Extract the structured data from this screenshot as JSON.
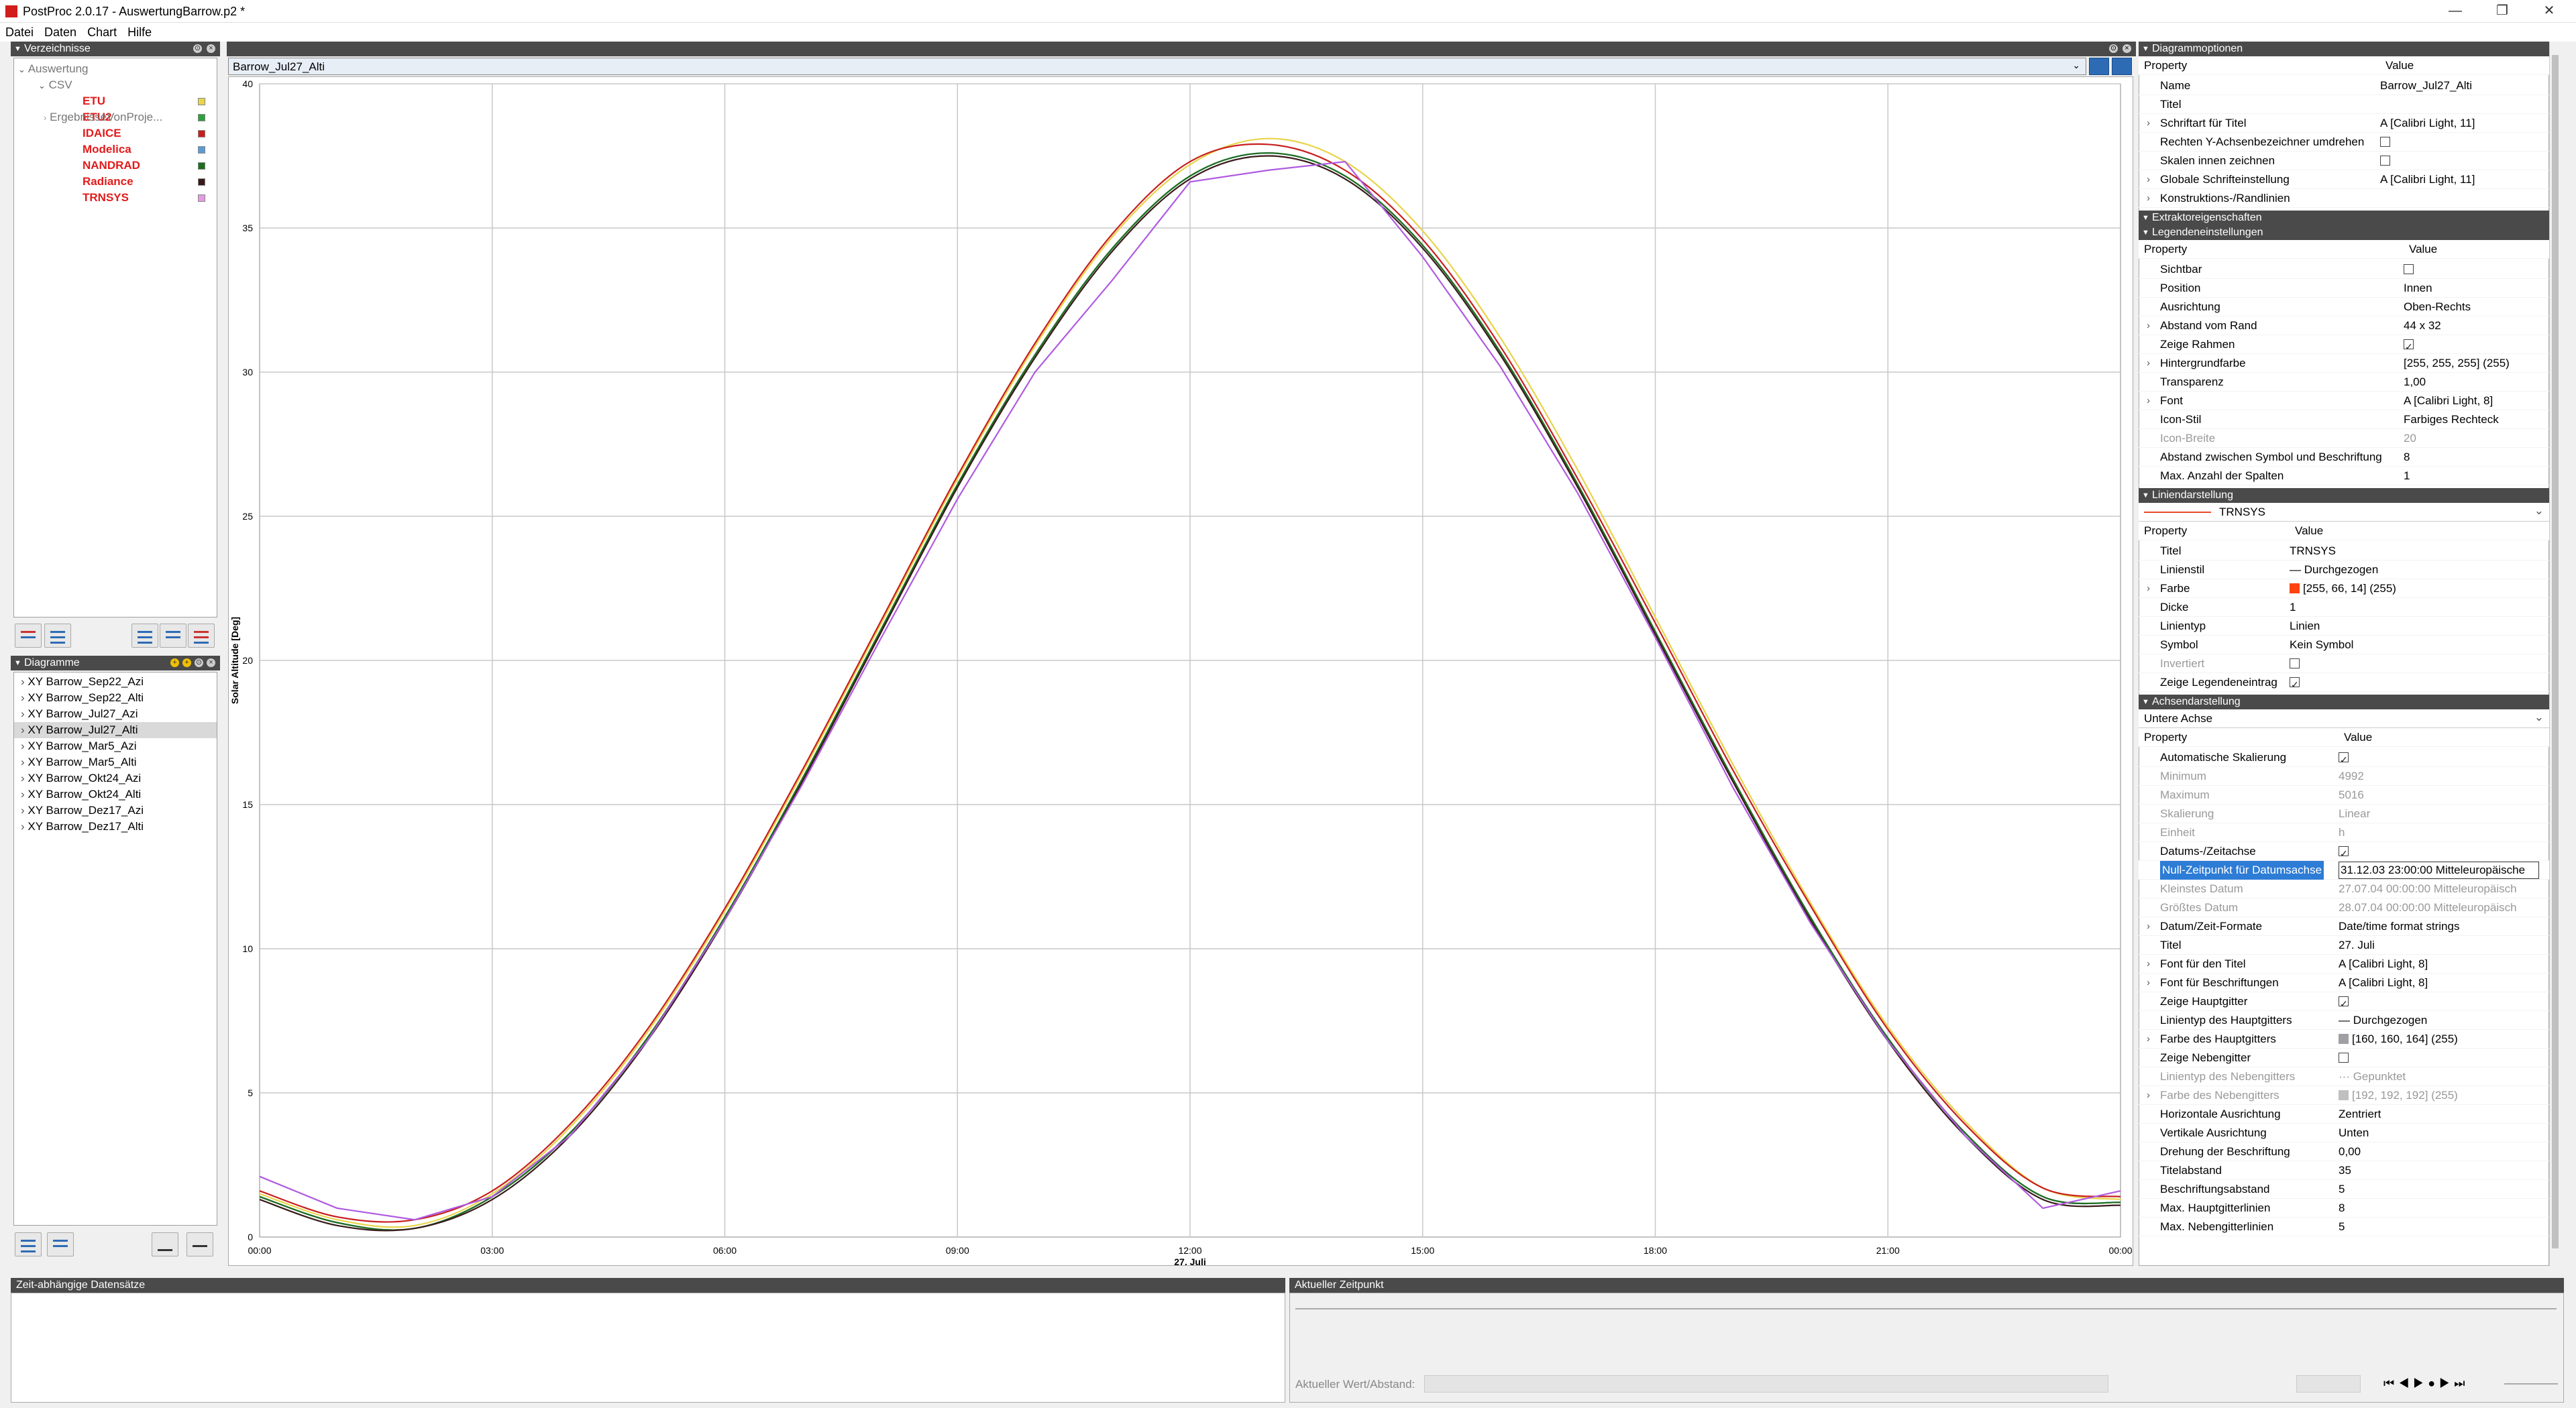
{
  "window": {
    "title": "PostProc 2.0.17 - AuswertungBarrow.p2 *",
    "min": "—",
    "max": "❐",
    "close": "✕"
  },
  "menu": [
    "Datei",
    "Daten",
    "Chart",
    "Hilfe"
  ],
  "verzeichnisse": {
    "title": "Verzeichnisse",
    "root": "Auswertung",
    "csv": "CSV",
    "items": [
      {
        "label": "ETU",
        "color": "#e8d44a"
      },
      {
        "label": "ETU2",
        "color": "#2e9e3e"
      },
      {
        "label": "IDAICE",
        "color": "#c81e1e"
      },
      {
        "label": "Modelica",
        "color": "#5b9bd5"
      },
      {
        "label": "NANDRAD",
        "color": "#1e6e1e"
      },
      {
        "label": "Radiance",
        "color": "#3a1a1a"
      },
      {
        "label": "TRNSYS",
        "color": "#e39be3"
      }
    ],
    "other": "ErgebnisseVonProje..."
  },
  "diagramme": {
    "title": "Diagramme",
    "items": [
      "XY Barrow_Sep22_Azi",
      "XY Barrow_Sep22_Alti",
      "XY Barrow_Jul27_Azi",
      "XY Barrow_Jul27_Alti",
      "XY Barrow_Mar5_Azi",
      "XY Barrow_Mar5_Alti",
      "XY Barrow_Okt24_Azi",
      "XY Barrow_Okt24_Alti",
      "XY Barrow_Dez17_Azi",
      "XY Barrow_Dez17_Alti"
    ],
    "selected": 3
  },
  "chart_tab": "Barrow_Jul27_Alti",
  "chart_data": {
    "type": "line",
    "ylabel": "Solar Altitude [Deg]",
    "xlabel": "27. Juli",
    "ylim": [
      0,
      40
    ],
    "yticks": [
      "0",
      "5",
      "10",
      "15",
      "20",
      "25",
      "30",
      "35",
      "40"
    ],
    "xticks": [
      "00:00",
      "03:00",
      "06:00",
      "09:00",
      "12:00",
      "15:00",
      "18:00",
      "21:00",
      "00:00"
    ],
    "x": [
      0,
      1,
      2,
      3,
      4,
      5,
      6,
      7,
      8,
      9,
      10,
      11,
      12,
      13,
      14,
      15,
      16,
      17,
      18,
      19,
      20,
      21,
      22,
      23,
      24
    ],
    "series": [
      {
        "name": "ETU",
        "color": "#e8d44a",
        "values": [
          1.5,
          0.6,
          0.4,
          1.5,
          3.8,
          7.1,
          11.3,
          16.1,
          21.2,
          26.3,
          30.9,
          34.7,
          37.2,
          38.1,
          37.3,
          34.9,
          31.2,
          26.6,
          21.5,
          16.4,
          11.6,
          7.3,
          4.0,
          1.7,
          1.3
        ]
      },
      {
        "name": "ETU2",
        "color": "#2e9e3e",
        "values": [
          1.4,
          0.5,
          0.3,
          1.4,
          3.6,
          6.9,
          11.1,
          15.9,
          21.0,
          26.1,
          30.6,
          34.3,
          36.8,
          37.6,
          36.8,
          34.4,
          30.7,
          26.1,
          21.0,
          15.9,
          11.1,
          6.9,
          3.6,
          1.4,
          1.2
        ]
      },
      {
        "name": "IDAICE",
        "color": "#c81e1e",
        "values": [
          1.6,
          0.7,
          0.6,
          1.6,
          3.9,
          7.2,
          11.4,
          16.2,
          21.3,
          26.4,
          31.0,
          34.8,
          37.3,
          37.9,
          37.0,
          34.6,
          30.9,
          26.3,
          21.3,
          16.2,
          11.5,
          7.2,
          3.9,
          1.7,
          1.4
        ]
      },
      {
        "name": "Modelica",
        "color": "#5b9bd5",
        "values": [
          1.4,
          0.5,
          0.3,
          1.4,
          3.6,
          6.9,
          11.1,
          15.9,
          21.0,
          26.1,
          30.6,
          34.3,
          36.8,
          37.6,
          36.8,
          34.4,
          30.7,
          26.1,
          21.0,
          15.9,
          11.1,
          6.9,
          3.6,
          1.4,
          1.2
        ]
      },
      {
        "name": "NANDRAD",
        "color": "#1e6e1e",
        "values": [
          1.4,
          0.5,
          0.3,
          1.4,
          3.6,
          6.9,
          11.1,
          15.9,
          21.0,
          26.1,
          30.6,
          34.3,
          36.8,
          37.6,
          36.8,
          34.4,
          30.7,
          26.1,
          21.0,
          15.9,
          11.1,
          6.9,
          3.6,
          1.4,
          1.2
        ]
      },
      {
        "name": "Radiance",
        "color": "#3a1a1a",
        "values": [
          1.3,
          0.4,
          0.3,
          1.3,
          3.5,
          6.8,
          11.0,
          15.8,
          20.9,
          26.0,
          30.5,
          34.2,
          36.7,
          37.5,
          36.7,
          34.3,
          30.6,
          26.0,
          20.9,
          15.8,
          11.0,
          6.8,
          3.5,
          1.3,
          1.1
        ]
      },
      {
        "name": "TRNSYS",
        "color": "#b05ae0",
        "values": [
          2.1,
          1.0,
          0.6,
          1.4,
          3.5,
          6.8,
          11.0,
          15.7,
          20.7,
          25.6,
          30.0,
          33.2,
          36.6,
          37.0,
          37.3,
          34.0,
          30.2,
          25.8,
          20.8,
          15.6,
          10.9,
          6.8,
          3.5,
          1.0,
          1.6
        ]
      }
    ]
  },
  "diagrammoptionen": {
    "title": "Diagrammoptionen",
    "header": [
      "Property",
      "Value"
    ],
    "rows": [
      [
        "Name",
        "Barrow_Jul27_Alti"
      ],
      [
        "Titel",
        ""
      ],
      [
        "Schriftart für Titel",
        "A [Calibri Light, 11]"
      ],
      [
        "Rechten Y-Achsenbezeichner umdrehen",
        ""
      ],
      [
        "Skalen innen zeichnen",
        ""
      ],
      [
        "Globale Schrifteinstellung",
        "A [Calibri Light, 11]"
      ],
      [
        "Konstruktions-/Randlinien",
        ""
      ]
    ]
  },
  "extraktor": "Extraktoreigenschaften",
  "legende": {
    "title": "Legendeneinstellungen",
    "header": [
      "Property",
      "Value"
    ],
    "rows": [
      [
        "Sichtbar",
        ""
      ],
      [
        "Position",
        "Innen"
      ],
      [
        "Ausrichtung",
        "Oben-Rechts"
      ],
      [
        "Abstand vom Rand",
        "44 x 32"
      ],
      [
        "Zeige Rahmen",
        ""
      ],
      [
        "Hintergrundfarbe",
        "[255, 255, 255] (255)"
      ],
      [
        "Transparenz",
        "1,00"
      ],
      [
        "Font",
        "A [Calibri Light, 8]"
      ],
      [
        "Icon-Stil",
        "Farbiges Rechteck"
      ],
      [
        "Icon-Breite",
        "20"
      ],
      [
        "Abstand zwischen Symbol und Beschriftung",
        "8"
      ],
      [
        "Max. Anzahl der Spalten",
        "1"
      ]
    ]
  },
  "linien": {
    "title": "Liniendarstellung",
    "selected": "TRNSYS",
    "header": [
      "Property",
      "Value"
    ],
    "rows": [
      [
        "Titel",
        "TRNSYS"
      ],
      [
        "Linienstil",
        "— Durchgezogen"
      ],
      [
        "Farbe",
        "[255, 66, 14] (255)"
      ],
      [
        "Dicke",
        "1"
      ],
      [
        "Linientyp",
        "Linien"
      ],
      [
        "Symbol",
        "Kein Symbol"
      ],
      [
        "Invertiert",
        ""
      ],
      [
        "Zeige Legendeneintrag",
        ""
      ]
    ]
  },
  "achsen": {
    "title": "Achsendarstellung",
    "selected": "Untere Achse",
    "header": [
      "Property",
      "Value"
    ],
    "rows": [
      [
        "Automatische Skalierung",
        ""
      ],
      [
        "Minimum",
        "4992"
      ],
      [
        "Maximum",
        "5016"
      ],
      [
        "Skalierung",
        "Linear"
      ],
      [
        "Einheit",
        "h"
      ],
      [
        "Datums-/Zeitachse",
        ""
      ],
      [
        "Null-Zeitpunkt für Datumsachse",
        "31.12.03 23:00:00 Mitteleuropäische"
      ],
      [
        "Kleinstes Datum",
        "27.07.04 00:00:00 Mitteleuropäisch"
      ],
      [
        "Größtes Datum",
        "28.07.04 00:00:00 Mitteleuropäisch"
      ],
      [
        "Datum/Zeit-Formate",
        "Date/time format strings"
      ],
      [
        "Titel",
        "27. Juli"
      ],
      [
        "Font für den Titel",
        "A [Calibri Light, 8]"
      ],
      [
        "Font für Beschriftungen",
        "A [Calibri Light, 8]"
      ],
      [
        "Zeige Hauptgitter",
        ""
      ],
      [
        "Linientyp des Hauptgitters",
        "— Durchgezogen"
      ],
      [
        "Farbe des Hauptgitters",
        "[160, 160, 164] (255)"
      ],
      [
        "Zeige Nebengitter",
        ""
      ],
      [
        "Linientyp des Nebengitters",
        "··· Gepunktet"
      ],
      [
        "Farbe des Nebengitters",
        "[192, 192, 192] (255)"
      ],
      [
        "Horizontale Ausrichtung",
        "Zentriert"
      ],
      [
        "Vertikale Ausrichtung",
        "Unten"
      ],
      [
        "Drehung der Beschriftung",
        "0,00"
      ],
      [
        "Titelabstand",
        "35"
      ],
      [
        "Beschriftungsabstand",
        "5"
      ],
      [
        "Max. Hauptgitterlinien",
        "8"
      ],
      [
        "Max. Nebengitterlinien",
        "5"
      ]
    ]
  },
  "bottom": {
    "left_title": "Zeit-abhängige Datensätze",
    "right_title": "Aktueller Zeitpunkt",
    "value_label": "Aktueller Wert/Abstand:"
  }
}
